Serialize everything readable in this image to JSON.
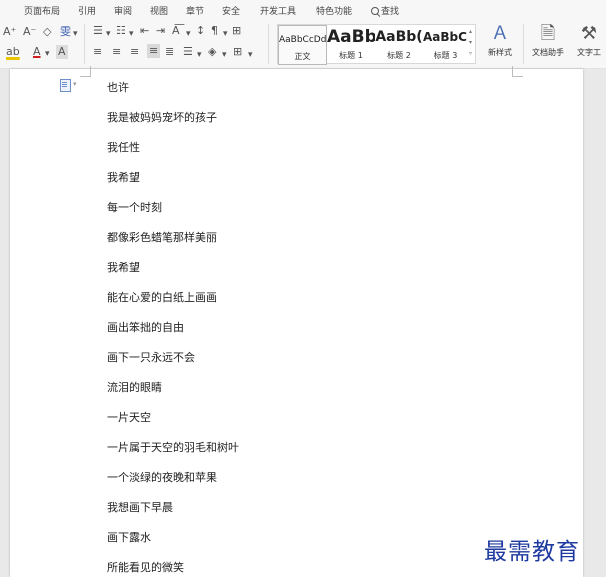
{
  "menu": [
    {
      "label": "页面布局"
    },
    {
      "label": "引用"
    },
    {
      "label": "审阅"
    },
    {
      "label": "视图"
    },
    {
      "label": "章节"
    },
    {
      "label": "安全"
    },
    {
      "label": "开发工具"
    },
    {
      "label": "特色功能"
    },
    {
      "label": "查找"
    }
  ],
  "ribbon": {
    "font_grow_label": "A⁺",
    "font_shrink_label": "A⁻",
    "eraser_label": "◇",
    "phonetic_label": "雯",
    "highlight_label": "ab",
    "font_color_label": "A",
    "char_shade_label": "A",
    "styles": [
      {
        "sample": "AaBbCcDd",
        "name": "正文"
      },
      {
        "sample": "AaBb",
        "name": "标题 1"
      },
      {
        "sample": "AaBb(",
        "name": "标题 2"
      },
      {
        "sample": "AaBbC(",
        "name": "标题 3"
      }
    ],
    "new_style_label": "新样式",
    "doc_helper_label": "文档助手",
    "text_tool_label": "文字工"
  },
  "document": {
    "lines": [
      "也许",
      "我是被妈妈宠坏的孩子",
      "我任性",
      "我希望",
      "每一个时刻",
      "都像彩色蜡笔那样美丽",
      "我希望",
      "能在心爱的白纸上画画",
      "画出笨拙的自由",
      "画下一只永远不会",
      "流泪的眼睛",
      "一片天空",
      "一片属于天空的羽毛和树叶",
      "一个淡绿的夜晚和苹果",
      "我想画下早晨",
      "画下露水",
      "所能看见的微笑"
    ]
  },
  "watermark": "最需教育",
  "colors": {
    "accent": "#4a6fb3",
    "watermark": "#1e3aa0"
  }
}
